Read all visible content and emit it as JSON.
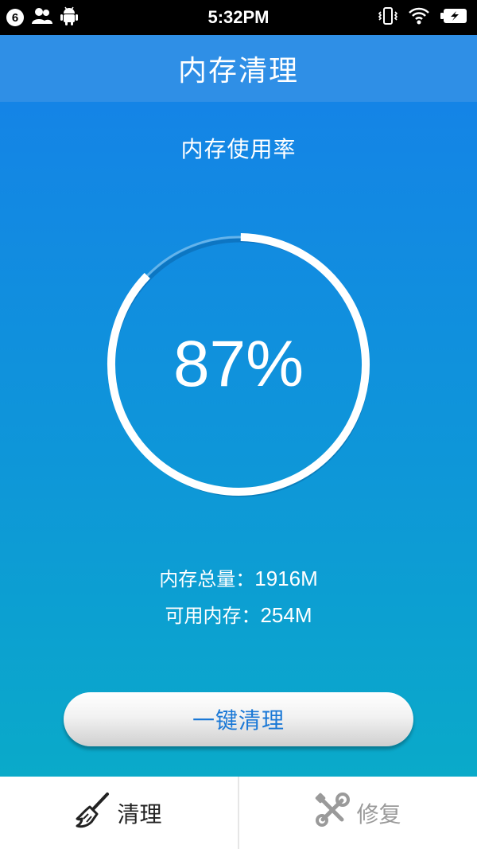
{
  "status_bar": {
    "notification_count": "6",
    "time": "5:32PM",
    "icons": [
      "contacts-icon",
      "android-icon",
      "vibrate-icon",
      "wifi-icon",
      "battery-charging-icon"
    ]
  },
  "header": {
    "title": "内存清理"
  },
  "main": {
    "usage_label": "内存使用率",
    "usage_percent_text": "87%",
    "usage_fraction": 0.87,
    "total_memory_label": "内存总量：",
    "total_memory_value": "1916M",
    "available_memory_label": "可用内存：",
    "available_memory_value": "254M",
    "clean_button_label": "一键清理"
  },
  "tabs": [
    {
      "label": "清理",
      "icon": "broom-icon",
      "selected": true
    },
    {
      "label": "修复",
      "icon": "tools-icon",
      "selected": false
    }
  ],
  "colors": {
    "header": "#2f8fe6",
    "gradient_top": "#1484e6",
    "gradient_bottom": "#0aaac9",
    "button_text": "#1a78d6",
    "tab_inactive": "#9a9a9a"
  }
}
